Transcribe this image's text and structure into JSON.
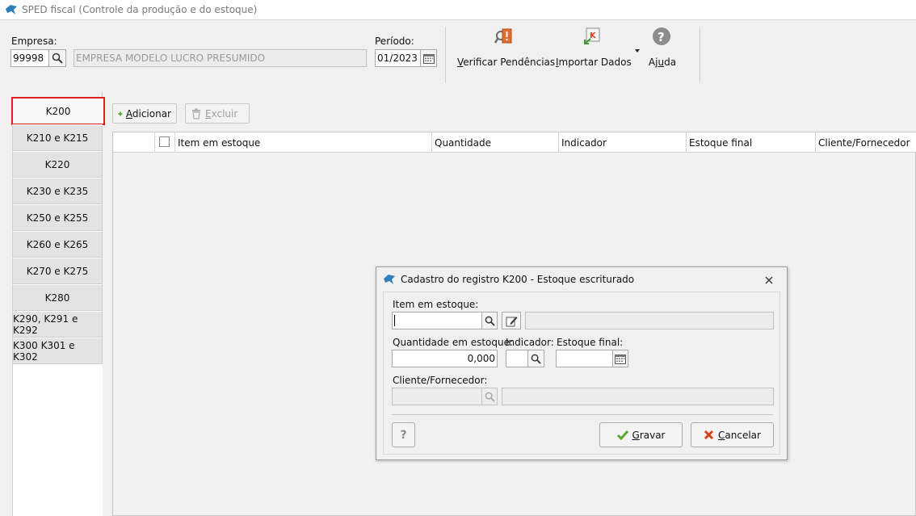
{
  "window": {
    "title": "SPED fiscal (Controle da produção e do estoque)"
  },
  "header": {
    "empresa_label": "Empresa:",
    "empresa_code": "99998",
    "empresa_name": "EMPRESA MODELO LUCRO PRESUMIDO",
    "periodo_label": "Período:",
    "periodo_value": "01/2023"
  },
  "toolbar": {
    "verificar": {
      "first": "V",
      "rest": "erificar Pendências"
    },
    "importar": {
      "first": "I",
      "rest": "mportar Dados"
    },
    "ajuda": {
      "pre": "Aj",
      "ul": "u",
      "post": "da"
    }
  },
  "tabs": [
    {
      "label": "K200"
    },
    {
      "label": "K210 e K215"
    },
    {
      "label": "K220"
    },
    {
      "label": "K230 e K235"
    },
    {
      "label": "K250 e K255"
    },
    {
      "label": "K260 e K265"
    },
    {
      "label": "K270 e K275"
    },
    {
      "label": "K280"
    },
    {
      "label": "K290, K291 e K292"
    },
    {
      "label": "K300 K301 e K302"
    }
  ],
  "actions": {
    "adicionar": {
      "first": "A",
      "rest": "dicionar"
    },
    "excluir": {
      "first": "E",
      "rest": "xcluir"
    }
  },
  "grid": {
    "columns": [
      "Item em estoque",
      "Quantidade",
      "Indicador",
      "Estoque final",
      "Cliente/Fornecedor"
    ]
  },
  "dialog": {
    "title": "Cadastro do registro K200 - Estoque escriturado",
    "item_label": "Item em estoque:",
    "quantidade_label": "Quantidade em estoque:",
    "quantidade_value": "0,000",
    "indicador_label": "Indicador:",
    "estoque_final_label": "Estoque final:",
    "cliente_label": "Cliente/Fornecedor:",
    "help_label": "?",
    "gravar": {
      "first": "G",
      "rest": "ravar"
    },
    "cancelar": {
      "first": "C",
      "rest": "ancelar"
    }
  },
  "colors": {
    "accent_red": "#e02020",
    "confirm_green": "#5aa82a",
    "cancel_red": "#d9421c"
  }
}
